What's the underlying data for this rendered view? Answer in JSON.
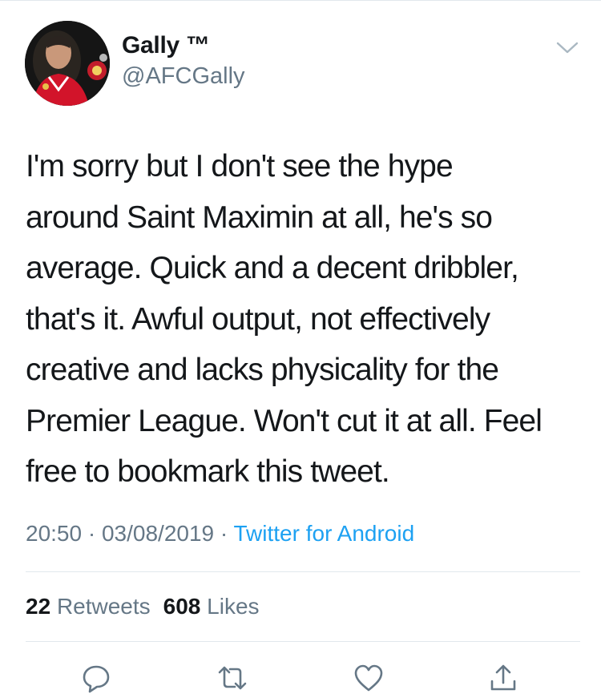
{
  "tweet": {
    "author": {
      "display_name": "Gally ™",
      "handle": "@AFCGally"
    },
    "text": "I'm sorry but I don't see the hype\naround Saint Maximin at all, he's so\naverage. Quick and a decent dribbler,\nthat's it. Awful output, not effectively\ncreative and lacks physicality for the\nPremier League. Won't cut it at all. Feel\nfree to bookmark this tweet.",
    "time": "20:50",
    "separator": " · ",
    "date": "03/08/2019",
    "source": "Twitter for Android"
  },
  "stats": {
    "retweets_count": "22",
    "retweets_label": "Retweets",
    "likes_count": "608",
    "likes_label": "Likes"
  },
  "icons": {
    "caret": "chevron-down-icon",
    "reply": "reply-icon",
    "retweet": "retweet-icon",
    "like": "heart-icon",
    "share": "share-icon"
  },
  "colors": {
    "text": "#14171a",
    "secondary": "#657786",
    "link": "#1da1f2",
    "divider": "#e1e8ed"
  }
}
